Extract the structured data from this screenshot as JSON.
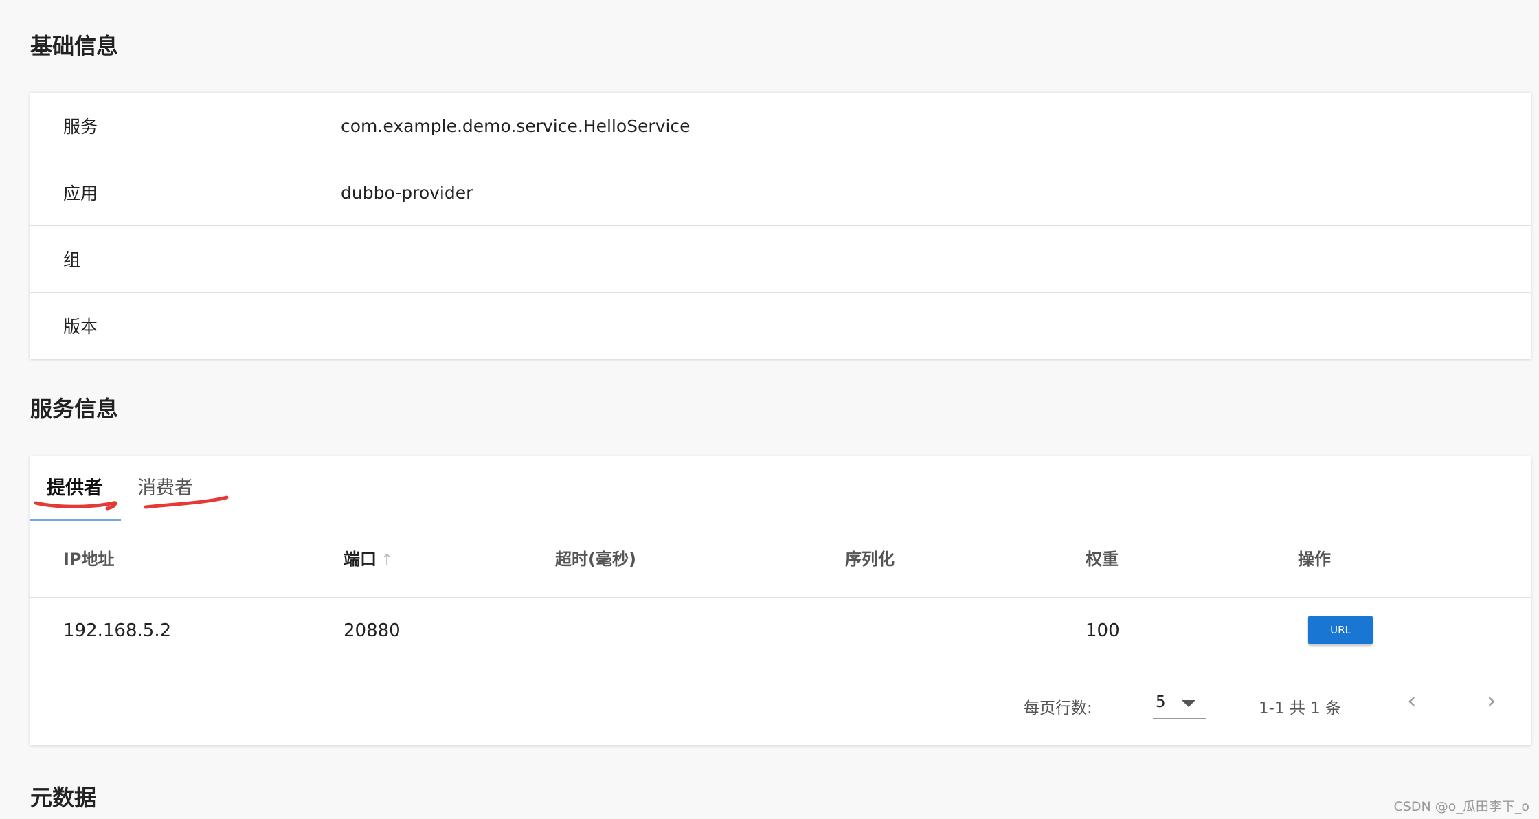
{
  "basic_info": {
    "title": "基础信息",
    "rows": [
      {
        "label": "服务",
        "value": "com.example.demo.service.HelloService"
      },
      {
        "label": "应用",
        "value": "dubbo-provider"
      },
      {
        "label": "组",
        "value": ""
      },
      {
        "label": "版本",
        "value": ""
      }
    ]
  },
  "service_info": {
    "title": "服务信息",
    "tabs": [
      {
        "label": "提供者",
        "active": true
      },
      {
        "label": "消费者",
        "active": false
      }
    ],
    "columns": [
      "IP地址",
      "端口",
      "超时(毫秒)",
      "序列化",
      "权重",
      "操作"
    ],
    "sort_icon": "arrow-up-icon",
    "rows": [
      {
        "ip": "192.168.5.2",
        "port": "20880",
        "timeout": "",
        "serialization": "",
        "weight": "100",
        "action_label": "URL"
      }
    ],
    "pagination": {
      "rows_per_page_label": "每页行数:",
      "rows_per_page": "5",
      "range_text": "1-1 共 1 条",
      "prev_icon": "chevron-left-icon",
      "next_icon": "chevron-right-icon"
    },
    "annotation_color": "#e53935",
    "action_button_color": "#1976d2"
  },
  "metadata": {
    "title": "元数据"
  },
  "watermark": "CSDN @o_瓜田李下_o"
}
